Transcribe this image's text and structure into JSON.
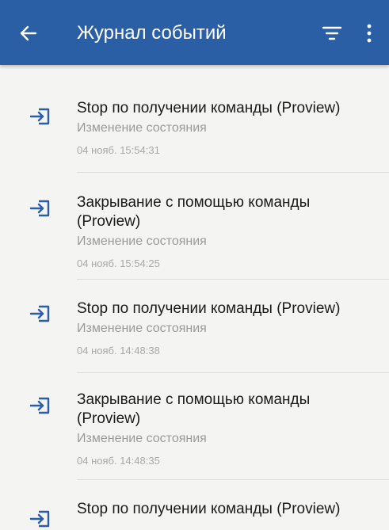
{
  "header": {
    "title": "Журнал событий",
    "back_icon": "arrow-left-icon",
    "filter_icon": "filter-icon",
    "more_icon": "more-vert-icon",
    "bar_color": "#2a5fa6"
  },
  "events": [
    {
      "title": "Stop по получении команды (Proview)",
      "type": "Изменение состояния",
      "time": "04 нояб. 15:54:31",
      "icon": "login-icon"
    },
    {
      "title": "Закрывание с помощью команды (Proview)",
      "type": "Изменение состояния",
      "time": "04 нояб. 15:54:25",
      "icon": "login-icon"
    },
    {
      "title": "Stop по получении команды (Proview)",
      "type": "Изменение состояния",
      "time": "04 нояб. 14:48:38",
      "icon": "login-icon"
    },
    {
      "title": "Закрывание с помощью команды (Proview)",
      "type": "Изменение состояния",
      "time": "04 нояб. 14:48:35",
      "icon": "login-icon"
    },
    {
      "title": "Stop по получении команды (Proview)",
      "type": "",
      "time": "",
      "icon": "login-icon"
    }
  ],
  "colors": {
    "accent": "#2a5fa6",
    "title_text": "#1a1a1a",
    "secondary_text": "#9a9a9a"
  }
}
